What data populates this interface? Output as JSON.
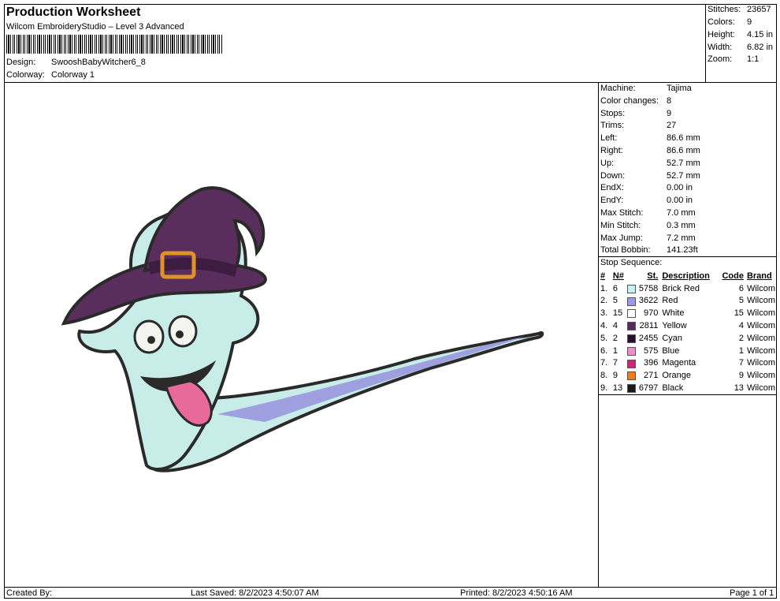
{
  "header": {
    "title": "Production Worksheet",
    "software": "Wilcom EmbroideryStudio – Level 3 Advanced",
    "design_label": "Design:",
    "design_value": "SwooshBabyWitcher6_8",
    "colorway_label": "Colorway:",
    "colorway_value": "Colorway 1"
  },
  "summary": [
    {
      "label": "Stitches:",
      "value": "23657"
    },
    {
      "label": "Colors:",
      "value": "9"
    },
    {
      "label": "Height:",
      "value": "4.15 in"
    },
    {
      "label": "Width:",
      "value": "6.82 in"
    },
    {
      "label": "Zoom:",
      "value": "1:1"
    }
  ],
  "machine_info": [
    {
      "label": "Machine:",
      "value": "Tajima"
    },
    {
      "label": "Color changes:",
      "value": "8"
    },
    {
      "label": "Stops:",
      "value": "9"
    },
    {
      "label": "Trims:",
      "value": "27"
    },
    {
      "label": "Left:",
      "value": "86.6 mm"
    },
    {
      "label": "Right:",
      "value": "86.6 mm"
    },
    {
      "label": "Up:",
      "value": "52.7 mm"
    },
    {
      "label": "Down:",
      "value": "52.7 mm"
    },
    {
      "label": "EndX:",
      "value": "0.00 in"
    },
    {
      "label": "EndY:",
      "value": "0.00 in"
    },
    {
      "label": "Max Stitch:",
      "value": "7.0 mm"
    },
    {
      "label": "Min Stitch:",
      "value": "0.3 mm"
    },
    {
      "label": "Max Jump:",
      "value": "7.2 mm"
    },
    {
      "label": "Total Bobbin:",
      "value": "141.23ft"
    }
  ],
  "stop_sequence": {
    "title": "Stop Sequence:",
    "headers": [
      "#",
      "N#",
      "St.",
      "Description",
      "Code",
      "Brand"
    ],
    "rows": [
      {
        "num": "1.",
        "n": "6",
        "color": "#c8f0f0",
        "st": "5758",
        "desc": "Brick Red",
        "code": "6",
        "brand": "Wilcom"
      },
      {
        "num": "2.",
        "n": "5",
        "color": "#9a9ae8",
        "st": "3622",
        "desc": "Red",
        "code": "5",
        "brand": "Wilcom"
      },
      {
        "num": "3.",
        "n": "15",
        "color": "#ffffff",
        "st": "970",
        "desc": "White",
        "code": "15",
        "brand": "Wilcom"
      },
      {
        "num": "4.",
        "n": "4",
        "color": "#5a2a5a",
        "st": "2811",
        "desc": "Yellow",
        "code": "4",
        "brand": "Wilcom"
      },
      {
        "num": "5.",
        "n": "2",
        "color": "#2a1030",
        "st": "2455",
        "desc": "Cyan",
        "code": "2",
        "brand": "Wilcom"
      },
      {
        "num": "6.",
        "n": "1",
        "color": "#f08cc8",
        "st": "575",
        "desc": "Blue",
        "code": "1",
        "brand": "Wilcom"
      },
      {
        "num": "7.",
        "n": "7",
        "color": "#d81f7a",
        "st": "396",
        "desc": "Magenta",
        "code": "7",
        "brand": "Wilcom"
      },
      {
        "num": "8.",
        "n": "9",
        "color": "#ee7d1e",
        "st": "271",
        "desc": "Orange",
        "code": "9",
        "brand": "Wilcom"
      },
      {
        "num": "9.",
        "n": "13",
        "color": "#1a1a1a",
        "st": "6797",
        "desc": "Black",
        "code": "13",
        "brand": "Wilcom"
      }
    ]
  },
  "footer": {
    "created_by": "Created By:",
    "last_saved": "Last Saved: 8/2/2023 4:50:07 AM",
    "printed": "Printed: 8/2/2023 4:50:16 AM",
    "page": "Page 1 of 1"
  },
  "design_colors": {
    "ghost": "#c8ece8",
    "ghost_shade": "#9ea0e0",
    "hat": "#5a2e5c",
    "hat_dark": "#3c1c40",
    "buckle": "#e0922a",
    "tongue": "#e86a9a",
    "outline": "#2a2a2a"
  }
}
